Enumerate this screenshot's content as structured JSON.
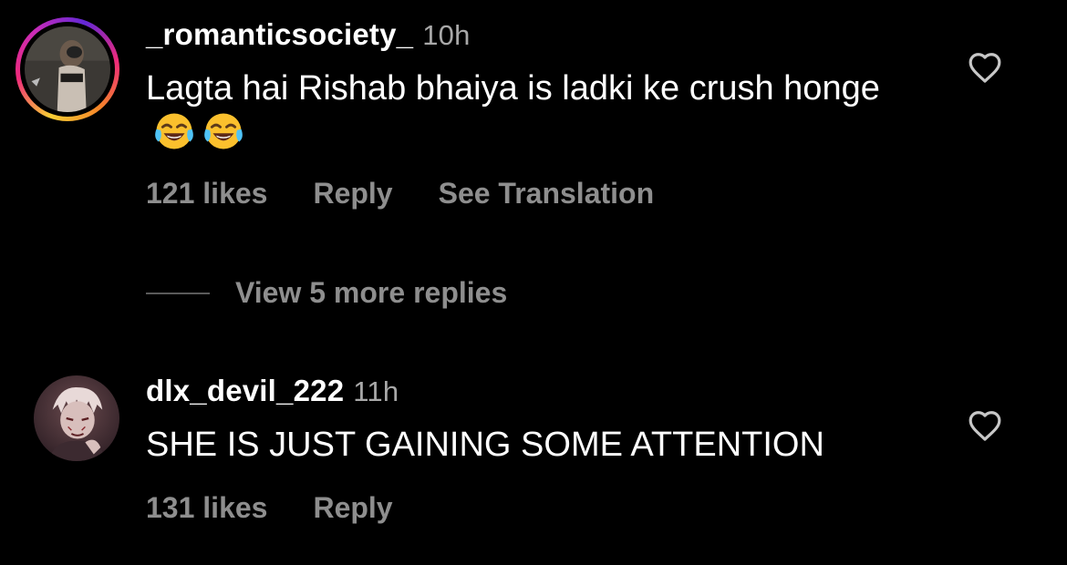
{
  "comments": [
    {
      "username": "_romanticsociety_",
      "time": "10h",
      "text": "Lagta hai Rishab bhaiya is ladki ke crush honge",
      "emoji": [
        "face-with-tears-of-joy-icon",
        "face-with-tears-of-joy-icon"
      ],
      "likes": "121 likes",
      "reply_label": "Reply",
      "translation_label": "See Translation",
      "has_story_ring": true
    },
    {
      "username": "dlx_devil_222",
      "time": "11h",
      "text": "SHE IS JUST GAINING SOME ATTENTION",
      "likes": "131 likes",
      "reply_label": "Reply",
      "has_story_ring": false
    }
  ],
  "replies_toggle": {
    "label": "View 5 more replies"
  },
  "icons": {
    "like": "heart-outline-icon"
  },
  "colors": {
    "background": "#000000",
    "primary_text": "#ffffff",
    "secondary_text": "#8e8e8e",
    "story_ring": [
      "#f9ce34",
      "#ee2a7b",
      "#6228d7"
    ]
  }
}
